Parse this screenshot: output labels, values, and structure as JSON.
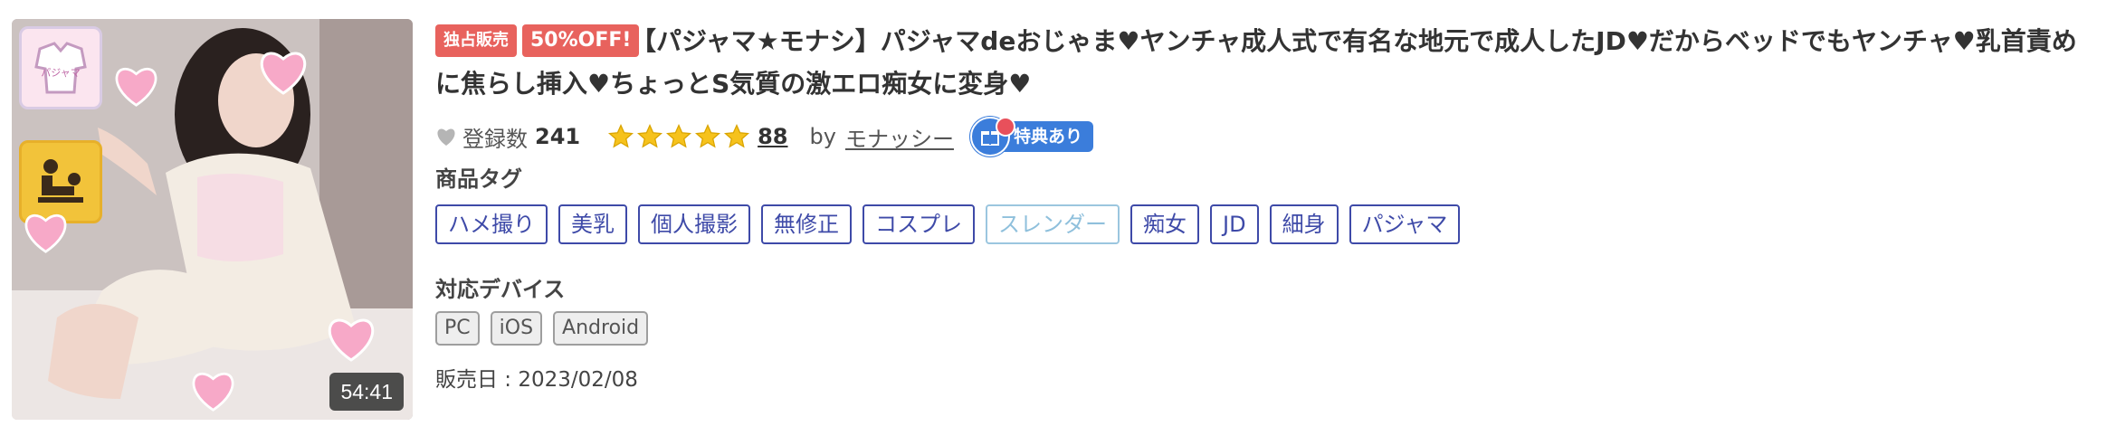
{
  "product": {
    "badges": {
      "exclusive": "独占販売",
      "discount": "50%OFF!"
    },
    "title": "【パジャマ★モナシ】パジャマdeおじゃま♥ヤンチャ成人式で有名な地元で成人したJD♥だからベッドでもヤンチャ♥乳首責めに焦らし挿入♥ちょっとS気質の激エロ痴女に変身♥",
    "duration": "54:41",
    "thumbnail_icons": {
      "pajama_label": "パジャマ"
    },
    "favorites": {
      "label": "登録数",
      "count": "241"
    },
    "rating": {
      "stars": 5,
      "review_count": "88"
    },
    "seller": {
      "by_label": "by",
      "name": "モナッシー"
    },
    "perk_label": "特典あり",
    "tags_label": "商品タグ",
    "tags": [
      "ハメ撮り",
      "美乳",
      "個人撮影",
      "無修正",
      "コスプレ",
      "スレンダー",
      "痴女",
      "JD",
      "細身",
      "パジャマ"
    ],
    "devices_label": "対応デバイス",
    "devices": [
      "PC",
      "iOS",
      "Android"
    ],
    "release": "販売日 : 2023/02/08"
  },
  "colors": {
    "badge": "#e8625d",
    "tag_border": "#3e4aa8",
    "tag_faded": "#9bc6df",
    "star": "#f6c21c",
    "perk": "#3b7ddb"
  }
}
